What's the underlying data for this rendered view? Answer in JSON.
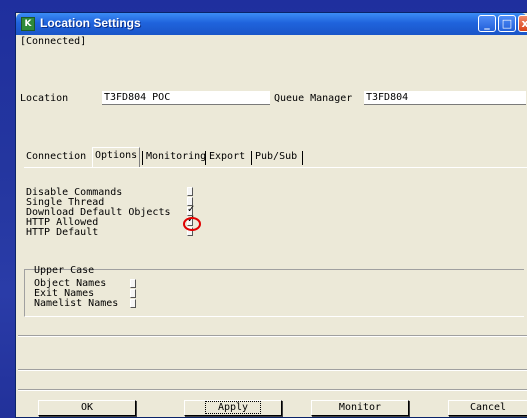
{
  "window": {
    "title": "Location Settings",
    "app_icon": "app-icon",
    "controls": {
      "minimize": "_",
      "maximize": "□",
      "close": "x"
    }
  },
  "status": "[Connected]",
  "location": {
    "label": "Location",
    "value": "T3FD804 POC"
  },
  "queue_manager": {
    "label": "Queue Manager",
    "value": "T3FD804"
  },
  "tabs": [
    {
      "label": "Connection"
    },
    {
      "label": "Options"
    },
    {
      "label": "Monitoring"
    },
    {
      "label": "Export"
    },
    {
      "label": "Pub/Sub"
    }
  ],
  "options": [
    {
      "label": "Disable Commands",
      "checked": false
    },
    {
      "label": "Single Thread",
      "checked": false
    },
    {
      "label": "Download Default Objects",
      "checked": true
    },
    {
      "label": "HTTP Allowed",
      "checked": true,
      "highlighted": true
    },
    {
      "label": "HTTP Default",
      "checked": false
    }
  ],
  "upper_case": {
    "title": "Upper Case",
    "items": [
      {
        "label": "Object Names",
        "checked": false
      },
      {
        "label": "Exit Names",
        "checked": false
      },
      {
        "label": "Namelist Names",
        "checked": false
      }
    ]
  },
  "buttons": {
    "ok": "OK",
    "apply": "Apply",
    "monitor": "Monitor",
    "cancel": "Cancel"
  },
  "colors": {
    "highlight_circle": "#e00000",
    "titlebar": "#1f63dc"
  }
}
